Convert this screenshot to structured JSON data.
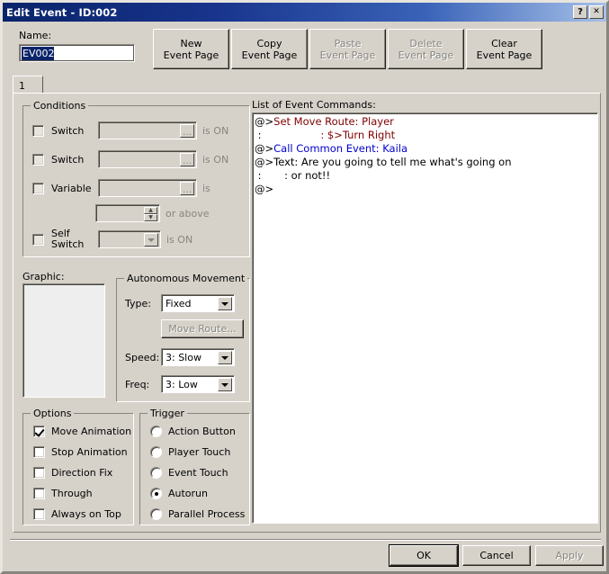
{
  "window": {
    "title": "Edit Event - ID:002",
    "help_button": "?",
    "close_button": "✕"
  },
  "name_section": {
    "label": "Name:",
    "value": "EV002"
  },
  "page_buttons": [
    {
      "line1": "New",
      "line2": "Event Page",
      "enabled": true
    },
    {
      "line1": "Copy",
      "line2": "Event Page",
      "enabled": true
    },
    {
      "line1": "Paste",
      "line2": "Event Page",
      "enabled": false
    },
    {
      "line1": "Delete",
      "line2": "Event Page",
      "enabled": false
    },
    {
      "line1": "Clear",
      "line2": "Event Page",
      "enabled": true
    }
  ],
  "tabs": [
    {
      "label": "1",
      "active": true
    }
  ],
  "conditions": {
    "title": "Conditions",
    "rows": [
      {
        "label": "Switch",
        "checked": false,
        "value": "",
        "suffix": "is ON",
        "control": "field"
      },
      {
        "label": "Switch",
        "checked": false,
        "value": "",
        "suffix": "is ON",
        "control": "field"
      },
      {
        "label": "Variable",
        "checked": false,
        "value": "",
        "suffix": "is",
        "control": "field"
      },
      {
        "label": "",
        "checked": null,
        "value": "",
        "suffix": "or above",
        "control": "spinner"
      },
      {
        "label": "Self\nSwitch",
        "checked": false,
        "value": "",
        "suffix": "is ON",
        "control": "combo"
      }
    ]
  },
  "graphic": {
    "label": "Graphic:"
  },
  "autonomous_movement": {
    "title": "Autonomous Movement",
    "type_label": "Type:",
    "type_value": "Fixed",
    "move_route_button": "Move Route...",
    "move_route_enabled": false,
    "speed_label": "Speed:",
    "speed_value": "3: Slow",
    "freq_label": "Freq:",
    "freq_value": "3: Low"
  },
  "options": {
    "title": "Options",
    "items": [
      {
        "label": "Move Animation",
        "checked": true
      },
      {
        "label": "Stop Animation",
        "checked": false
      },
      {
        "label": "Direction Fix",
        "checked": false
      },
      {
        "label": "Through",
        "checked": false
      },
      {
        "label": "Always on Top",
        "checked": false
      }
    ]
  },
  "trigger": {
    "title": "Trigger",
    "items": [
      {
        "label": "Action Button",
        "selected": false
      },
      {
        "label": "Player Touch",
        "selected": false
      },
      {
        "label": "Event Touch",
        "selected": false
      },
      {
        "label": "Autorun",
        "selected": true
      },
      {
        "label": "Parallel Process",
        "selected": false
      }
    ]
  },
  "commands": {
    "label": "List of Event Commands:",
    "colors": {
      "default": "#000000",
      "move_route": "#800000",
      "common_event": "#0000cd"
    },
    "lines": [
      {
        "prefix": "@>",
        "text": "Set Move Route: Player",
        "color": "#800000",
        "indent": 0
      },
      {
        "prefix": " : ",
        "text": "                 : $>Turn Right",
        "color": "#800000",
        "indent": 0
      },
      {
        "prefix": "@>",
        "text": "Call Common Event: Kaila",
        "color": "#0000cd",
        "indent": 0
      },
      {
        "prefix": "@>",
        "text": "Text: Are you going to tell me what's going on",
        "color": "#000000",
        "indent": 0
      },
      {
        "prefix": " : ",
        "text": "      : or not!!",
        "color": "#000000",
        "indent": 0
      },
      {
        "prefix": "@>",
        "text": "",
        "color": "#000000",
        "indent": 0
      }
    ]
  },
  "footer": {
    "ok": "OK",
    "cancel": "Cancel",
    "apply": "Apply",
    "apply_enabled": false
  }
}
